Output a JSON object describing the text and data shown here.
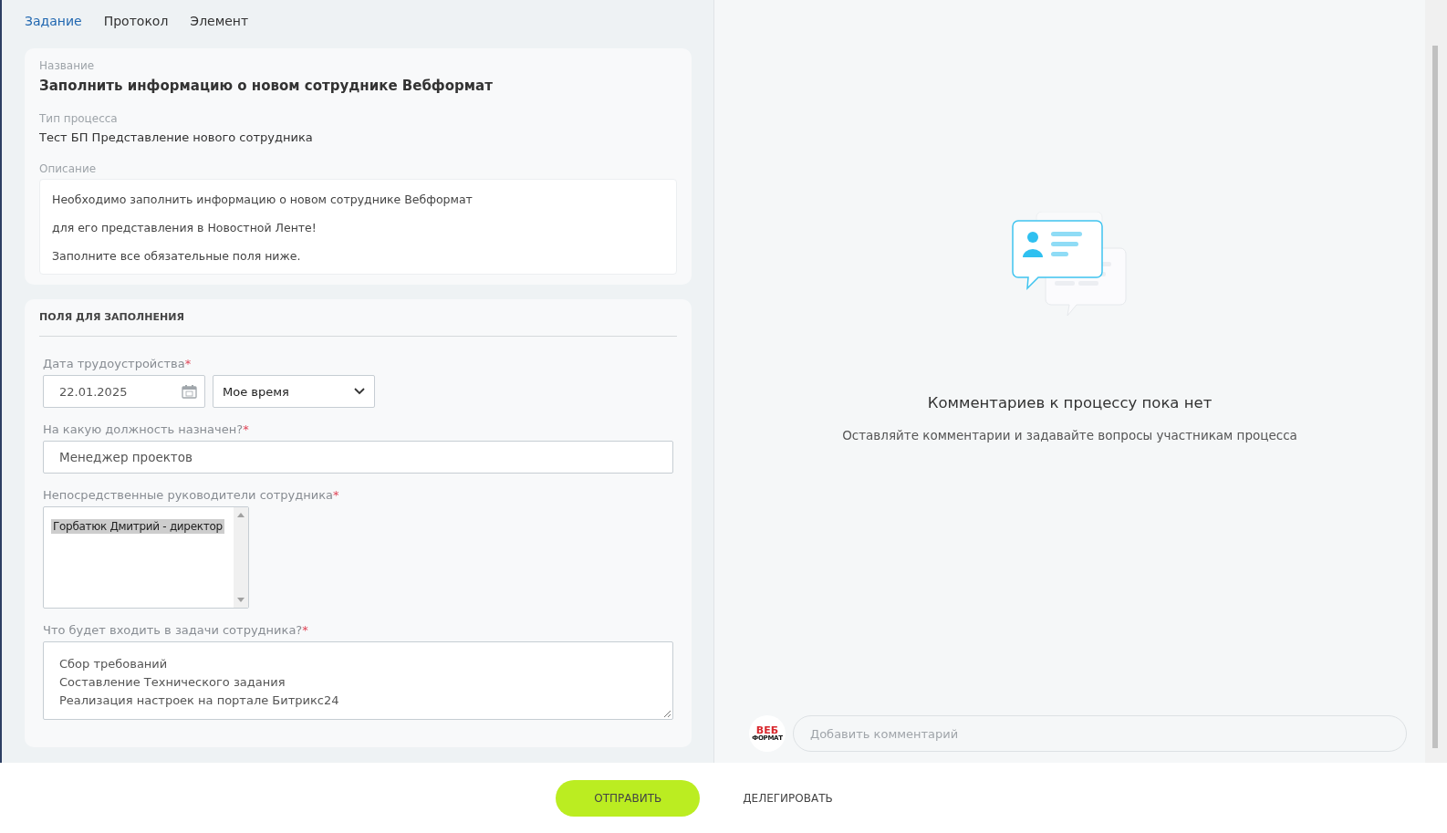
{
  "tabs": [
    {
      "label": "Задание",
      "selected": true
    },
    {
      "label": "Протокол",
      "selected": false
    },
    {
      "label": "Элемент",
      "selected": false
    }
  ],
  "info": {
    "name_label": "Название",
    "name": "Заполнить информацию о новом сотруднике Вебформат",
    "type_label": "Тип процесса",
    "type": "Тест БП Представление нового сотрудника",
    "description_label": "Описание",
    "description": [
      "Необходимо заполнить информацию о новом сотруднике Вебформат",
      "для его представления в Новостной Ленте!",
      "Заполните все обязательные поля ниже."
    ]
  },
  "fields_section": {
    "title": "ПОЛЯ ДЛЯ ЗАПОЛНЕНИЯ",
    "fields": [
      {
        "kind": "date",
        "label": "Дата трудоустройства",
        "required_mark": "*",
        "value": "22.01.2025",
        "timezone": "Мое время"
      },
      {
        "kind": "text",
        "label": "На какую должность назначен?",
        "required_mark": "*",
        "value": "Менеджер проектов"
      },
      {
        "kind": "listbox",
        "label": "Непосредственные руководители сотрудника",
        "required_mark": "*",
        "options": [
          {
            "label": "Горбатюк Дмитрий - директор",
            "selected": true
          }
        ]
      },
      {
        "kind": "textarea",
        "label": "Что будет входить в задачи сотрудника?",
        "required_mark": "*",
        "lines": [
          "Сбор требований",
          "Составление Технического задания",
          "Реализация настроек на портале Битрикс24"
        ]
      }
    ]
  },
  "comments": {
    "empty_title": "Комментариев к процессу пока нет",
    "empty_hint": "Оставляйте комментарии и задавайте вопросы участникам процесса",
    "avatar_logo": [
      "ВЕБ",
      "ФОРМАТ"
    ],
    "placeholder": "Добавить комментарий"
  },
  "actions": [
    {
      "label": "ОТПРАВИТЬ",
      "kind": "primary"
    },
    {
      "label": "ДЕЛЕГИРОВАТЬ",
      "kind": "link"
    }
  ]
}
